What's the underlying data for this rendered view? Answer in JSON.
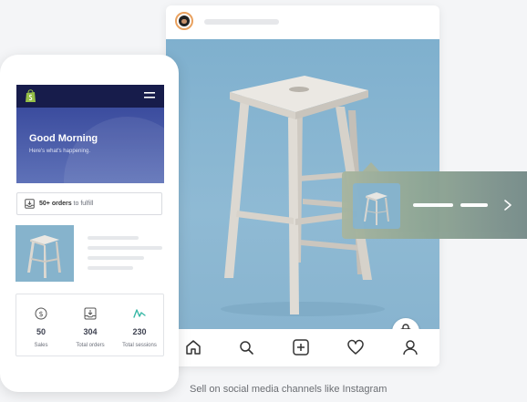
{
  "phone": {
    "greeting": "Good Morning",
    "greeting_sub": "Here's what's happening.",
    "orders": {
      "count_text": "50+ orders",
      "suffix_text": " to fulfill"
    },
    "stats": [
      {
        "icon": "dollar-icon",
        "value": "50",
        "label": "Sales"
      },
      {
        "icon": "inbox-download-icon",
        "value": "304",
        "label": "Total orders"
      },
      {
        "icon": "activity-line-icon",
        "value": "230",
        "label": "Total sessions"
      }
    ]
  },
  "instagram": {
    "nav_icons": [
      "home-icon",
      "search-icon",
      "add-post-icon",
      "heart-icon",
      "profile-icon"
    ]
  },
  "caption": "Sell on social media channels like Instagram",
  "colors": {
    "app_bar": "#171c4b",
    "hero_top": "#3b4c9e",
    "shopify_green": "#95bf47",
    "sessions_teal": "#39b8a6",
    "photo_blue": "#86b3cc"
  }
}
